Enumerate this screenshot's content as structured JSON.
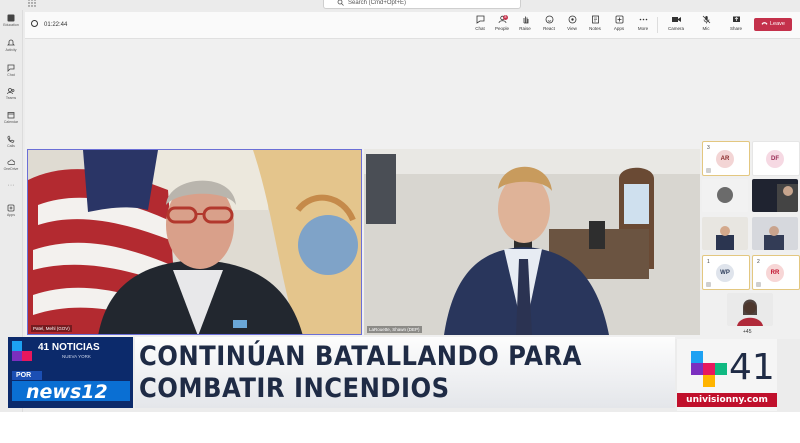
{
  "rail": {
    "items": [
      {
        "label": "Activity",
        "icon": "bell-icon"
      },
      {
        "label": "Chat",
        "icon": "chat-icon"
      },
      {
        "label": "Teams",
        "icon": "teams-icon"
      },
      {
        "label": "Calendar",
        "icon": "calendar-icon"
      },
      {
        "label": "Calls",
        "icon": "phone-icon"
      },
      {
        "label": "OneDrive",
        "icon": "cloud-icon"
      },
      {
        "label": "Apps",
        "icon": "add-app-icon"
      }
    ],
    "top_label": "Education"
  },
  "search": {
    "placeholder": "Search (Cmd+Opt+E)"
  },
  "toolbar": {
    "timer": "01:22:44",
    "buttons": [
      "Chat",
      "People",
      "Raise",
      "React",
      "View",
      "Notes",
      "Apps",
      "More"
    ],
    "people_badge": "8",
    "camera": "Camera",
    "mic": "Mic",
    "share": "Share",
    "leave": "Leave"
  },
  "participants": {
    "left_name": "Patel, Mehl (GOV)",
    "right_name": "LaRouette, Shawn (DEP)",
    "tiles": [
      {
        "initials": "AR",
        "count": "3",
        "color": "#f3d5d5",
        "text_color": "#8a2b2b"
      },
      {
        "initials": "DF",
        "color": "#f6d9e3",
        "text_color": "#9a2b55"
      },
      {
        "initials": "WP",
        "count": "1",
        "color": "#dfe4ec",
        "text_color": "#2e3e5c"
      },
      {
        "initials": "RR",
        "count": "2",
        "color": "#f7d6d6",
        "text_color": "#c0102c"
      }
    ],
    "overflow": "+45"
  },
  "broadcast": {
    "logo_top": "41 NOTICIAS",
    "logo_city": "NUEVA YORK",
    "logo_por": "POR",
    "logo_news": "news12",
    "headline_line1": "CONTINÚAN BATALLANDO PARA",
    "headline_line2": "COMBATIR INCENDIOS",
    "channel_number": "41",
    "channel_url": "univisionny.com",
    "brand_colors": {
      "navy": "#0c2a6b",
      "red": "#c0102c",
      "ink": "#1f2b45"
    }
  }
}
